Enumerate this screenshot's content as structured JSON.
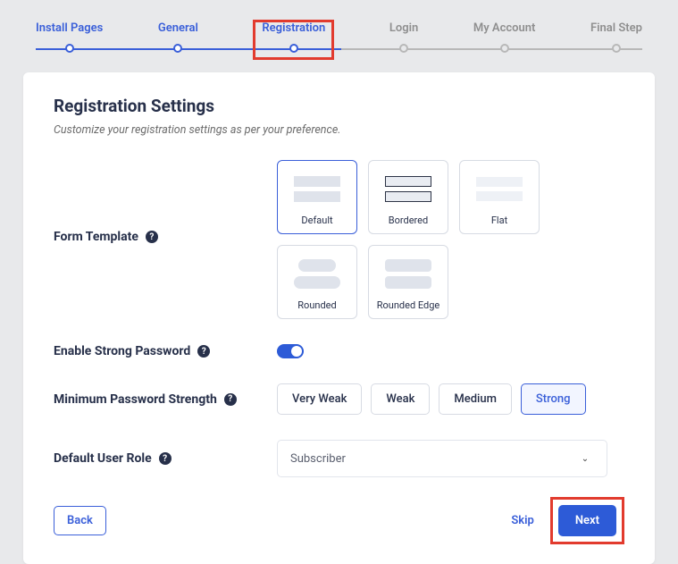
{
  "stepper": {
    "steps": [
      {
        "label": "Install Pages",
        "state": "done"
      },
      {
        "label": "General",
        "state": "done"
      },
      {
        "label": "Registration",
        "state": "active"
      },
      {
        "label": "Login",
        "state": "pending"
      },
      {
        "label": "My Account",
        "state": "pending"
      },
      {
        "label": "Final Step",
        "state": "pending"
      }
    ]
  },
  "page": {
    "title": "Registration Settings",
    "subtitle": "Customize your registration settings as per your preference."
  },
  "form_template": {
    "label": "Form Template",
    "options": [
      {
        "name": "Default",
        "style": "default",
        "selected": true
      },
      {
        "name": "Bordered",
        "style": "bordered",
        "selected": false
      },
      {
        "name": "Flat",
        "style": "flat",
        "selected": false
      },
      {
        "name": "Rounded",
        "style": "rounded",
        "selected": false
      },
      {
        "name": "Rounded Edge",
        "style": "redge",
        "selected": false
      }
    ]
  },
  "strong_password": {
    "label": "Enable Strong Password",
    "enabled": true
  },
  "min_strength": {
    "label": "Minimum Password Strength",
    "options": [
      "Very Weak",
      "Weak",
      "Medium",
      "Strong"
    ],
    "selected": "Strong"
  },
  "user_role": {
    "label": "Default User Role",
    "value": "Subscriber"
  },
  "footer": {
    "back": "Back",
    "skip": "Skip",
    "next": "Next"
  },
  "colors": {
    "primary": "#2d5bd7",
    "highlight": "#e23b2e"
  }
}
